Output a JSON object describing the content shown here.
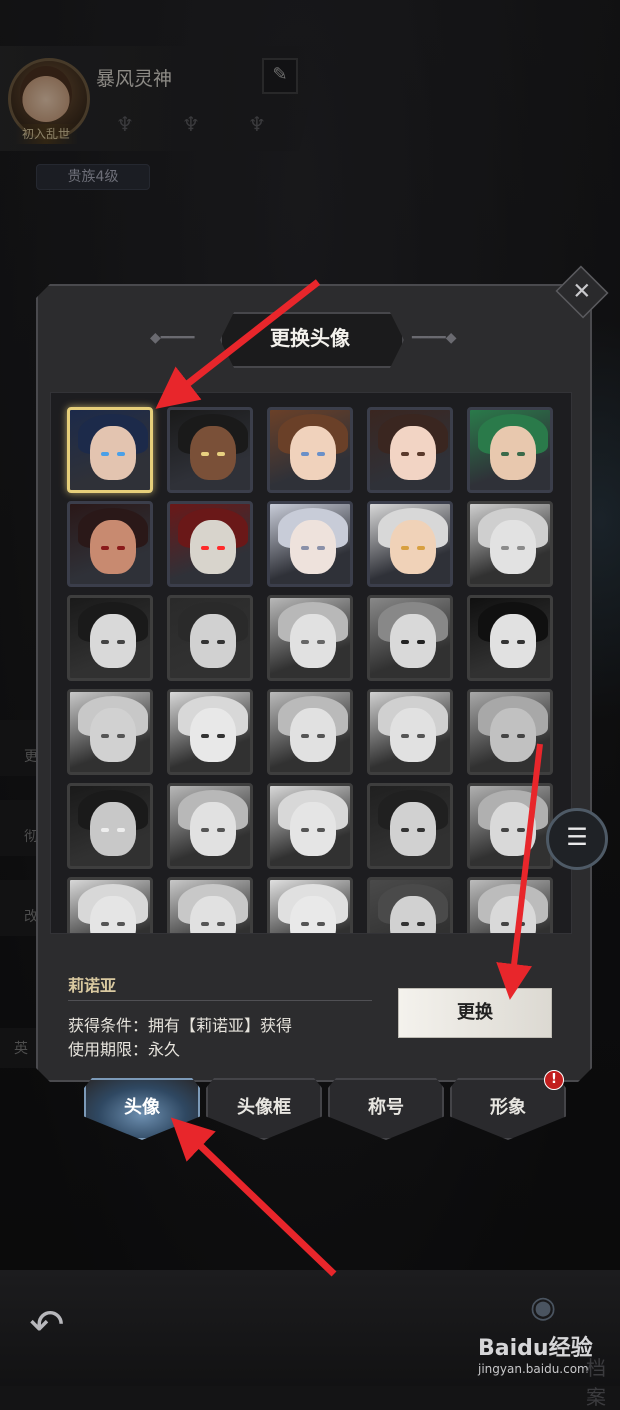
{
  "profile": {
    "player_name": "暴风灵神",
    "avatar_tag": "初入乱世",
    "noble_level": "贵族4级",
    "edit_icon": "pencil-icon"
  },
  "side_stubs": [
    "更",
    "彻",
    "改"
  ],
  "side_bottom": "英",
  "modal": {
    "title": "更换头像",
    "close_icon": "close-icon",
    "selected": {
      "name": "莉诺亚",
      "condition": "获得条件：拥有【莉诺亚】获得",
      "limit": "使用期限：永久"
    },
    "change_button": "更换"
  },
  "avatars": [
    {
      "hair": "#1c2a4a",
      "skin": "#e3c4b0",
      "eye": "#4aa0e8",
      "gray": false,
      "selected": true
    },
    {
      "hair": "#1a1a1a",
      "skin": "#7a5038",
      "eye": "#e8d080",
      "gray": false,
      "selected": false
    },
    {
      "hair": "#6a4028",
      "skin": "#f0d2bc",
      "eye": "#6a90c8",
      "gray": false,
      "selected": false
    },
    {
      "hair": "#3a2620",
      "skin": "#f2d4c4",
      "eye": "#5a3a2c",
      "gray": false,
      "selected": false
    },
    {
      "hair": "#2a7a4a",
      "skin": "#e8c8ae",
      "eye": "#3a6a4a",
      "gray": false,
      "selected": false
    },
    {
      "hair": "#2a1818",
      "skin": "#c88a70",
      "eye": "#8a1a1a",
      "gray": false,
      "selected": false
    },
    {
      "hair": "#6a1818",
      "skin": "#d8d4cc",
      "eye": "#ff2a2a",
      "gray": false,
      "selected": false
    },
    {
      "hair": "#c8ccd8",
      "skin": "#eee2dc",
      "eye": "#8a90a8",
      "gray": false,
      "selected": false
    },
    {
      "hair": "#d8d8d8",
      "skin": "#f0d2b8",
      "eye": "#d8a040",
      "gray": false,
      "selected": false
    },
    {
      "hair": "#d8d0b0",
      "skin": "#f0e0d0",
      "eye": "#9a8a6a",
      "gray": true,
      "selected": false
    },
    {
      "hair": "#1a1a1a",
      "skin": "#e0d8d0",
      "eye": "#444",
      "gray": true,
      "selected": false
    },
    {
      "hair": "#2a2a2a",
      "skin": "#d8d0c8",
      "eye": "#333",
      "gray": true,
      "selected": false
    },
    {
      "hair": "#b8b8b8",
      "skin": "#e8e0d8",
      "eye": "#666",
      "gray": true,
      "selected": false
    },
    {
      "hair": "#888",
      "skin": "#e0d8d0",
      "eye": "#222",
      "gray": true,
      "selected": false
    },
    {
      "hair": "#101010",
      "skin": "#e8e0d8",
      "eye": "#333",
      "gray": true,
      "selected": false
    },
    {
      "hair": "#c8c8c8",
      "skin": "#d8d0c8",
      "eye": "#555",
      "gray": true,
      "selected": false
    },
    {
      "hair": "#d8d8d8",
      "skin": "#e8e8e8",
      "eye": "#333",
      "gray": true,
      "selected": false
    },
    {
      "hair": "#bababa",
      "skin": "#e8e0d8",
      "eye": "#555",
      "gray": true,
      "selected": false
    },
    {
      "hair": "#d0d0d0",
      "skin": "#e8e0d8",
      "eye": "#555",
      "gray": true,
      "selected": false
    },
    {
      "hair": "#a8a8a8",
      "skin": "#c8c0b8",
      "eye": "#444",
      "gray": true,
      "selected": false
    },
    {
      "hair": "#1a1a1a",
      "skin": "#c8c8c8",
      "eye": "#eee",
      "gray": true,
      "selected": false
    },
    {
      "hair": "#b8b8b8",
      "skin": "#e8e0d8",
      "eye": "#555",
      "gray": true,
      "selected": false
    },
    {
      "hair": "#d8d8d8",
      "skin": "#ece4dc",
      "eye": "#555",
      "gray": true,
      "selected": false
    },
    {
      "hair": "#202020",
      "skin": "#d8d0c8",
      "eye": "#333",
      "gray": true,
      "selected": false
    },
    {
      "hair": "#b0b0b0",
      "skin": "#e0d8d0",
      "eye": "#444",
      "gray": true,
      "selected": false
    },
    {
      "hair": "#d8d8d8",
      "skin": "#ece4dc",
      "eye": "#555",
      "gray": true,
      "selected": false
    },
    {
      "hair": "#c8c8c8",
      "skin": "#e8e0d8",
      "eye": "#555",
      "gray": true,
      "selected": false
    },
    {
      "hair": "#e0e0e0",
      "skin": "#f0e8e0",
      "eye": "#555",
      "gray": true,
      "selected": false
    },
    {
      "hair": "#4a4a4a",
      "skin": "#d8d0c8",
      "eye": "#333",
      "gray": true,
      "selected": false
    },
    {
      "hair": "#bcbcbc",
      "skin": "#e0d8d0",
      "eye": "#444",
      "gray": true,
      "selected": false
    }
  ],
  "tabs": [
    {
      "label": "头像",
      "active": true
    },
    {
      "label": "头像框",
      "active": false
    },
    {
      "label": "称号",
      "active": false
    },
    {
      "label": "形象",
      "active": false
    }
  ],
  "tab_alert": "!",
  "chat_icon": "chat-bubble-icon",
  "back_icon": "back-arrow-icon",
  "watermark": {
    "title": "Baidu经验",
    "url": "jingyan.baidu.com",
    "tail": "档案"
  },
  "colors": {
    "selected_border": "#e6cf7a",
    "tab_active": "#6d8fb0",
    "annotation_arrow": "#e8262b",
    "item_name": "#d9c9a0"
  }
}
